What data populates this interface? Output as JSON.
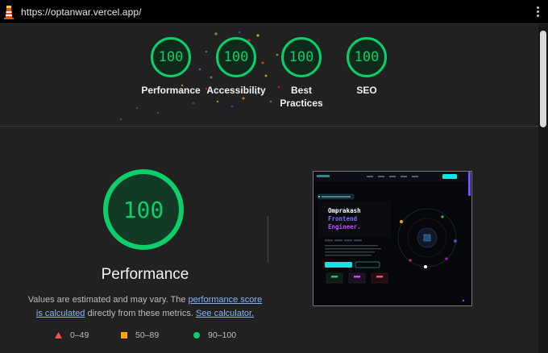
{
  "browser": {
    "url": "https://optanwar.vercel.app/",
    "menu_icon": "kebab-menu-icon",
    "logo_icon": "lighthouse-icon"
  },
  "summary_gauges": [
    {
      "score": "100",
      "label": "Performance"
    },
    {
      "score": "100",
      "label": "Accessibility"
    },
    {
      "score": "100",
      "label": "Best Practices"
    },
    {
      "score": "100",
      "label": "SEO"
    }
  ],
  "main": {
    "score": "100",
    "title": "Performance",
    "desc_prefix": "Values are estimated and may vary. The ",
    "desc_link1": "performance score is calculated",
    "desc_mid": " directly from these metrics. ",
    "desc_link2": "See calculator."
  },
  "legend": [
    {
      "icon": "triangle-icon",
      "range": "0–49",
      "color": "#ff4e42"
    },
    {
      "icon": "square-icon",
      "range": "50–89",
      "color": "#ffa400"
    },
    {
      "icon": "circle-icon",
      "range": "90–100",
      "color": "#0cce6b"
    }
  ],
  "colors": {
    "pass": "#0cce6b",
    "background": "#212121",
    "link": "#8ab4f8"
  },
  "thumbnail": {
    "line1": "Omprakash",
    "line2": "Frontend",
    "line3": "Engineer."
  }
}
